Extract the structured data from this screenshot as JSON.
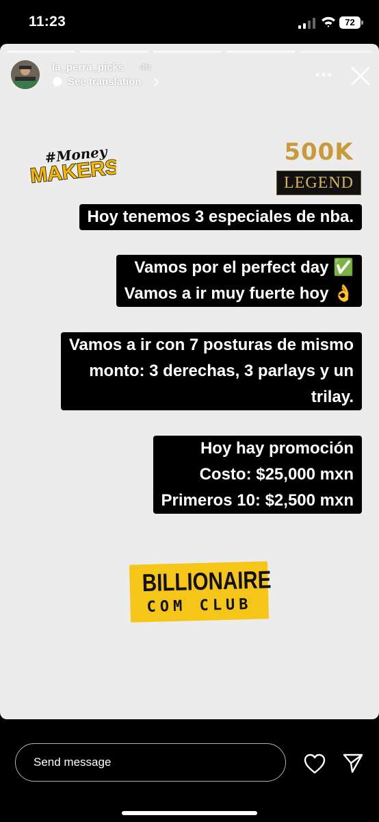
{
  "status_bar": {
    "time": "11:23",
    "battery": "72"
  },
  "story": {
    "username": "la_perra_picks",
    "time_ago": "4h",
    "translate_label": "See translation",
    "logos": {
      "money_makers_hashtag": "#Money",
      "money_makers_word": "MAKERS",
      "k500": "500K",
      "legend": "LEGEND",
      "billionaire_line1": "BILLIONAIRE",
      "billionaire_line2": "COM CLUB"
    },
    "texts": {
      "block1": "Hoy tenemos 3 especiales de nba.",
      "block2": [
        "Vamos por el perfect day ✅",
        "Vamos a ir muy fuerte hoy 👌"
      ],
      "block3": [
        "Vamos a ir con 7 posturas de mismo",
        "monto: 3 derechas, 3 parlays y un",
        "trilay."
      ],
      "block4": [
        "Hoy hay promoción",
        "Costo: $25,000 mxn",
        "Primeros 10: $2,500 mxn"
      ]
    }
  },
  "reply": {
    "placeholder": "Send message"
  },
  "icons": [
    "signal-icon",
    "wifi-icon",
    "battery-icon",
    "translate-icon",
    "chevron-right-icon",
    "more-icon",
    "close-icon",
    "heart-icon",
    "send-icon"
  ],
  "colors": {
    "story_bg": "#ececec",
    "text_box": "#000000",
    "billionaire_yellow": "#f5c518",
    "gold": "#c79a3a"
  }
}
